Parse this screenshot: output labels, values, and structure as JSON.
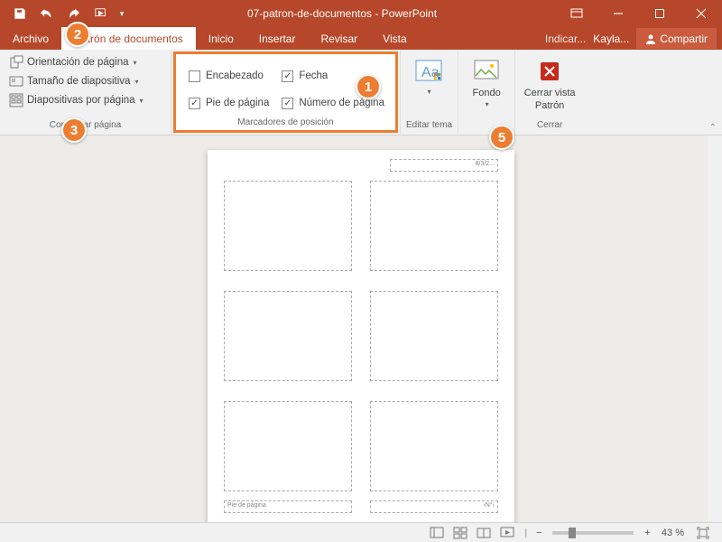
{
  "title": "07-patron-de-documentos - PowerPoint",
  "user": "Kayla...",
  "share": "Compartir",
  "search_hint": "Indicar...",
  "tabs": {
    "file": "Archivo",
    "handout": "Patrón de documentos",
    "home": "Inicio",
    "insert": "Insertar",
    "review": "Revisar",
    "view": "Vista"
  },
  "page_setup": {
    "orientation": "Orientación de página",
    "slide_size": "Tamaño de diapositiva",
    "slides_per_page": "Diapositivas por página",
    "group_label": "Configurar página"
  },
  "placeholders": {
    "header": "Encabezado",
    "date": "Fecha",
    "footer": "Pie de página",
    "page_number": "Número de página",
    "group_label": "Marcadores de posición",
    "header_checked": false,
    "date_checked": true,
    "footer_checked": true,
    "page_number_checked": true
  },
  "theme": {
    "label": "",
    "group_label": "Editar tema"
  },
  "background": {
    "label": "Fondo"
  },
  "close": {
    "line1": "Cerrar vista",
    "line2": "Patrón",
    "group_label": "Cerrar"
  },
  "page": {
    "date": "8/3/2...",
    "footer": "Pie de página",
    "page_no": "‹N°›"
  },
  "status": {
    "zoom": "43 %"
  },
  "badges": {
    "b1": "1",
    "b2": "2",
    "b3": "3",
    "b5": "5"
  }
}
